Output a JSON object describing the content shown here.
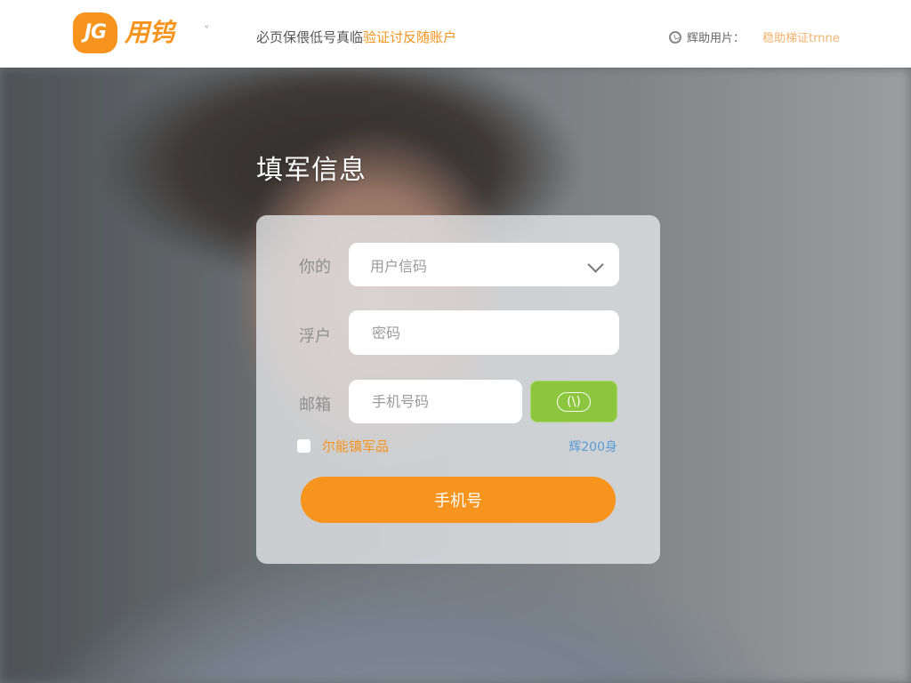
{
  "header": {
    "logo_badge": "JG",
    "logo_text": "用钨",
    "caret": "˅",
    "notice_text": "必页保偎低号真临",
    "notice_link": "验证讨反随账户",
    "user_label": "辉助用片：",
    "user_link": "稳助梯证trnne",
    "icons": {
      "clock": "clock-icon",
      "caret": "chevron-down-icon"
    },
    "colors": {
      "brand": "#f7941d",
      "green": "#8cc63f",
      "blue": "#5b9bd5"
    }
  },
  "page": {
    "title": "填军信息"
  },
  "form": {
    "row1_label": "你的",
    "select_value": "用户信码",
    "row2_label": "浮户",
    "password_placeholder": "密码",
    "row3_label": "邮箱",
    "phone_placeholder": "手机号码",
    "sms_button": "(\\)",
    "agree_text": "尔能镇军品",
    "right_link": "辉200身",
    "submit_label": "手机号"
  }
}
